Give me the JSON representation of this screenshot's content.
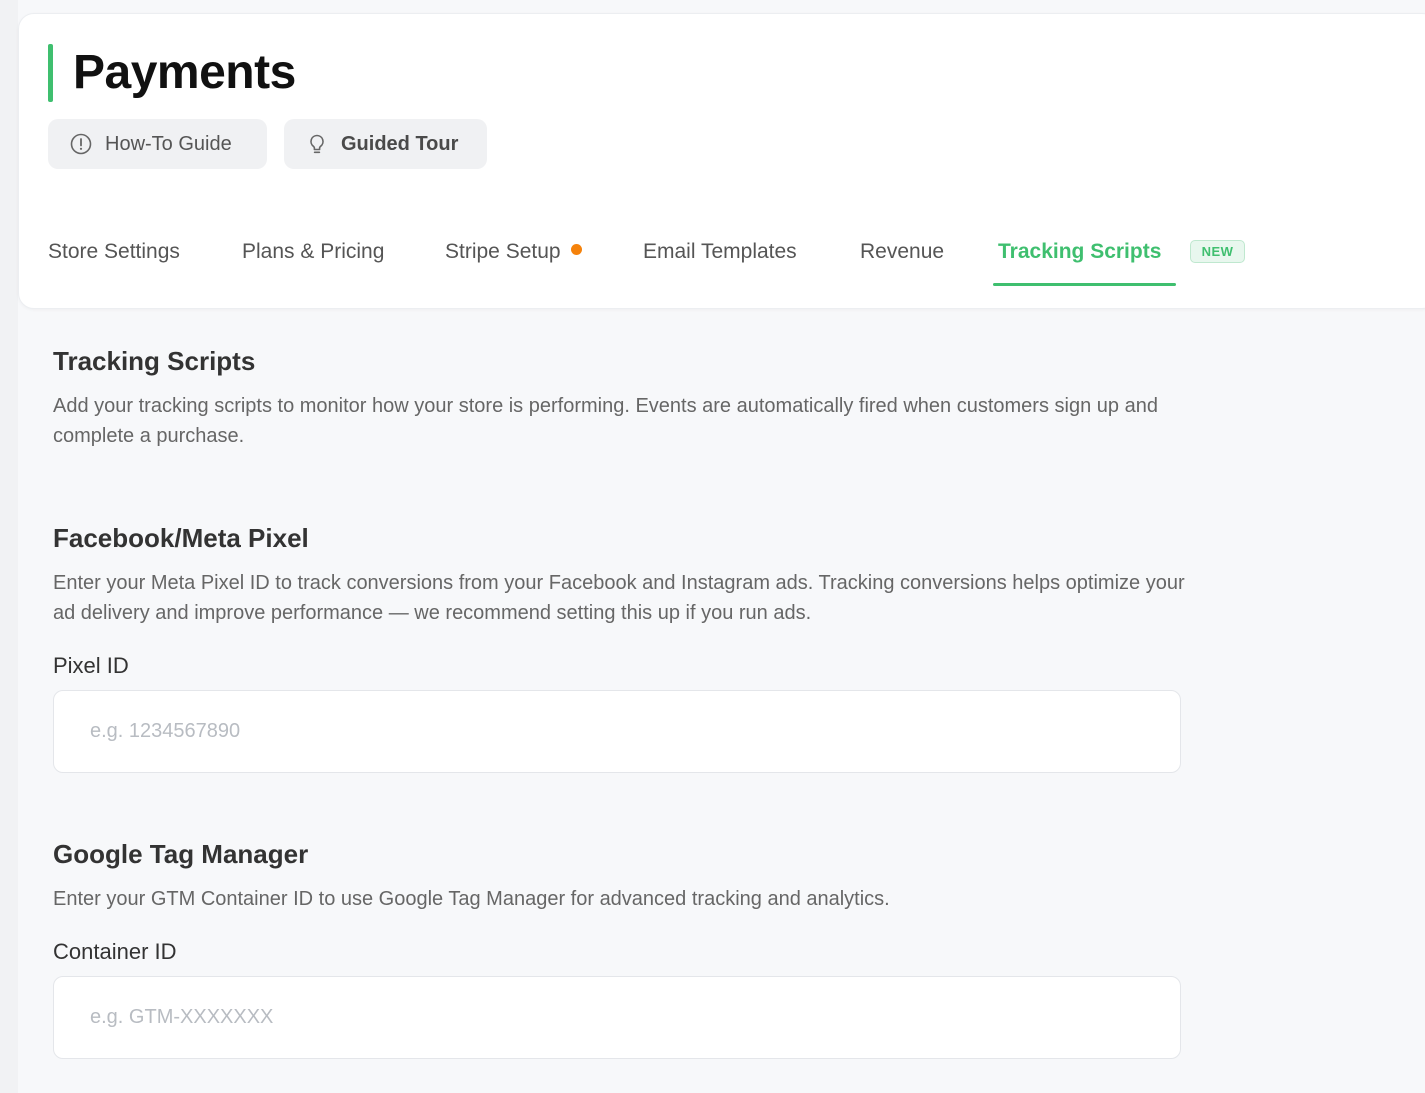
{
  "page": {
    "title": "Payments",
    "accent_color": "#3fbf6f",
    "warning_color": "#f5820b"
  },
  "actions": {
    "howto_label": "How-To Guide",
    "howto_icon": "info-circle-icon",
    "tour_label": "Guided Tour",
    "tour_icon": "lightbulb-icon"
  },
  "tabs": [
    {
      "label": "Store Settings",
      "active": false
    },
    {
      "label": "Plans & Pricing",
      "active": false
    },
    {
      "label": "Stripe Setup",
      "active": false,
      "indicator": "orange-dot"
    },
    {
      "label": "Email Templates",
      "active": false
    },
    {
      "label": "Revenue",
      "active": false
    },
    {
      "label": "Tracking Scripts",
      "active": true,
      "badge": "NEW"
    }
  ],
  "section": {
    "title": "Tracking Scripts",
    "description": "Add your tracking scripts to monitor how your store is performing. Events are automatically fired when customers sign up and complete a purchase."
  },
  "facebook": {
    "title": "Facebook/Meta Pixel",
    "description": "Enter your Meta Pixel ID to track conversions from your Facebook and Instagram ads. Tracking conversions helps optimize your ad delivery and improve performance — we recommend setting this up if you run ads.",
    "field_label": "Pixel ID",
    "placeholder": "e.g. 1234567890",
    "value": ""
  },
  "gtm": {
    "title": "Google Tag Manager",
    "description": "Enter your GTM Container ID to use Google Tag Manager for advanced tracking and analytics.",
    "field_label": "Container ID",
    "placeholder": "e.g. GTM-XXXXXXX",
    "value": ""
  }
}
